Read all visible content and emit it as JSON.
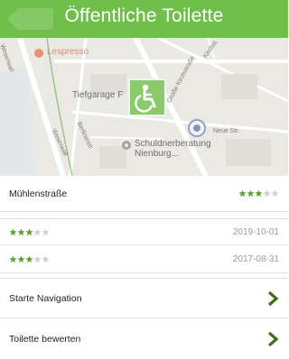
{
  "appbar": {
    "title": "Öffentliche Toilette"
  },
  "map": {
    "labels": {
      "poi_lesspresso": "Lespresso",
      "tiefgarage": "Tiefgarage F",
      "neue_str": "Neue Str.",
      "schuldnerberatung_line1": "Schuldnerberatung",
      "schuldnerberatung_line2": "Nienburg...",
      "grosse_kirchstrasse": "Große Kirchstraße",
      "kirchst": "Kirchst.",
      "weserwall": "Weserwall",
      "weserwall_alt": "Weserwall",
      "berliner": "Berlinerstr."
    },
    "wheelchair_marker_color": "#6fbf4a",
    "wc_icon": "wheelchair-icon"
  },
  "details": {
    "location": {
      "name": "Mühlenstraße",
      "rating": 3,
      "max_rating": 5
    },
    "reviews": [
      {
        "rating": 3,
        "max_rating": 5,
        "date": "2019-10-01"
      },
      {
        "rating": 3,
        "max_rating": 5,
        "date": "2017-08-31"
      }
    ],
    "actions": [
      {
        "label": "Starte Navigation",
        "icon": "chevron-right-icon"
      },
      {
        "label": "Toilette bewerten",
        "icon": "chevron-right-icon"
      }
    ]
  },
  "colors": {
    "accent": "#6fbf4a",
    "star_filled": "#5a9e2e",
    "star_empty": "#cfcfcf",
    "chevron": "#3f6e1e"
  }
}
